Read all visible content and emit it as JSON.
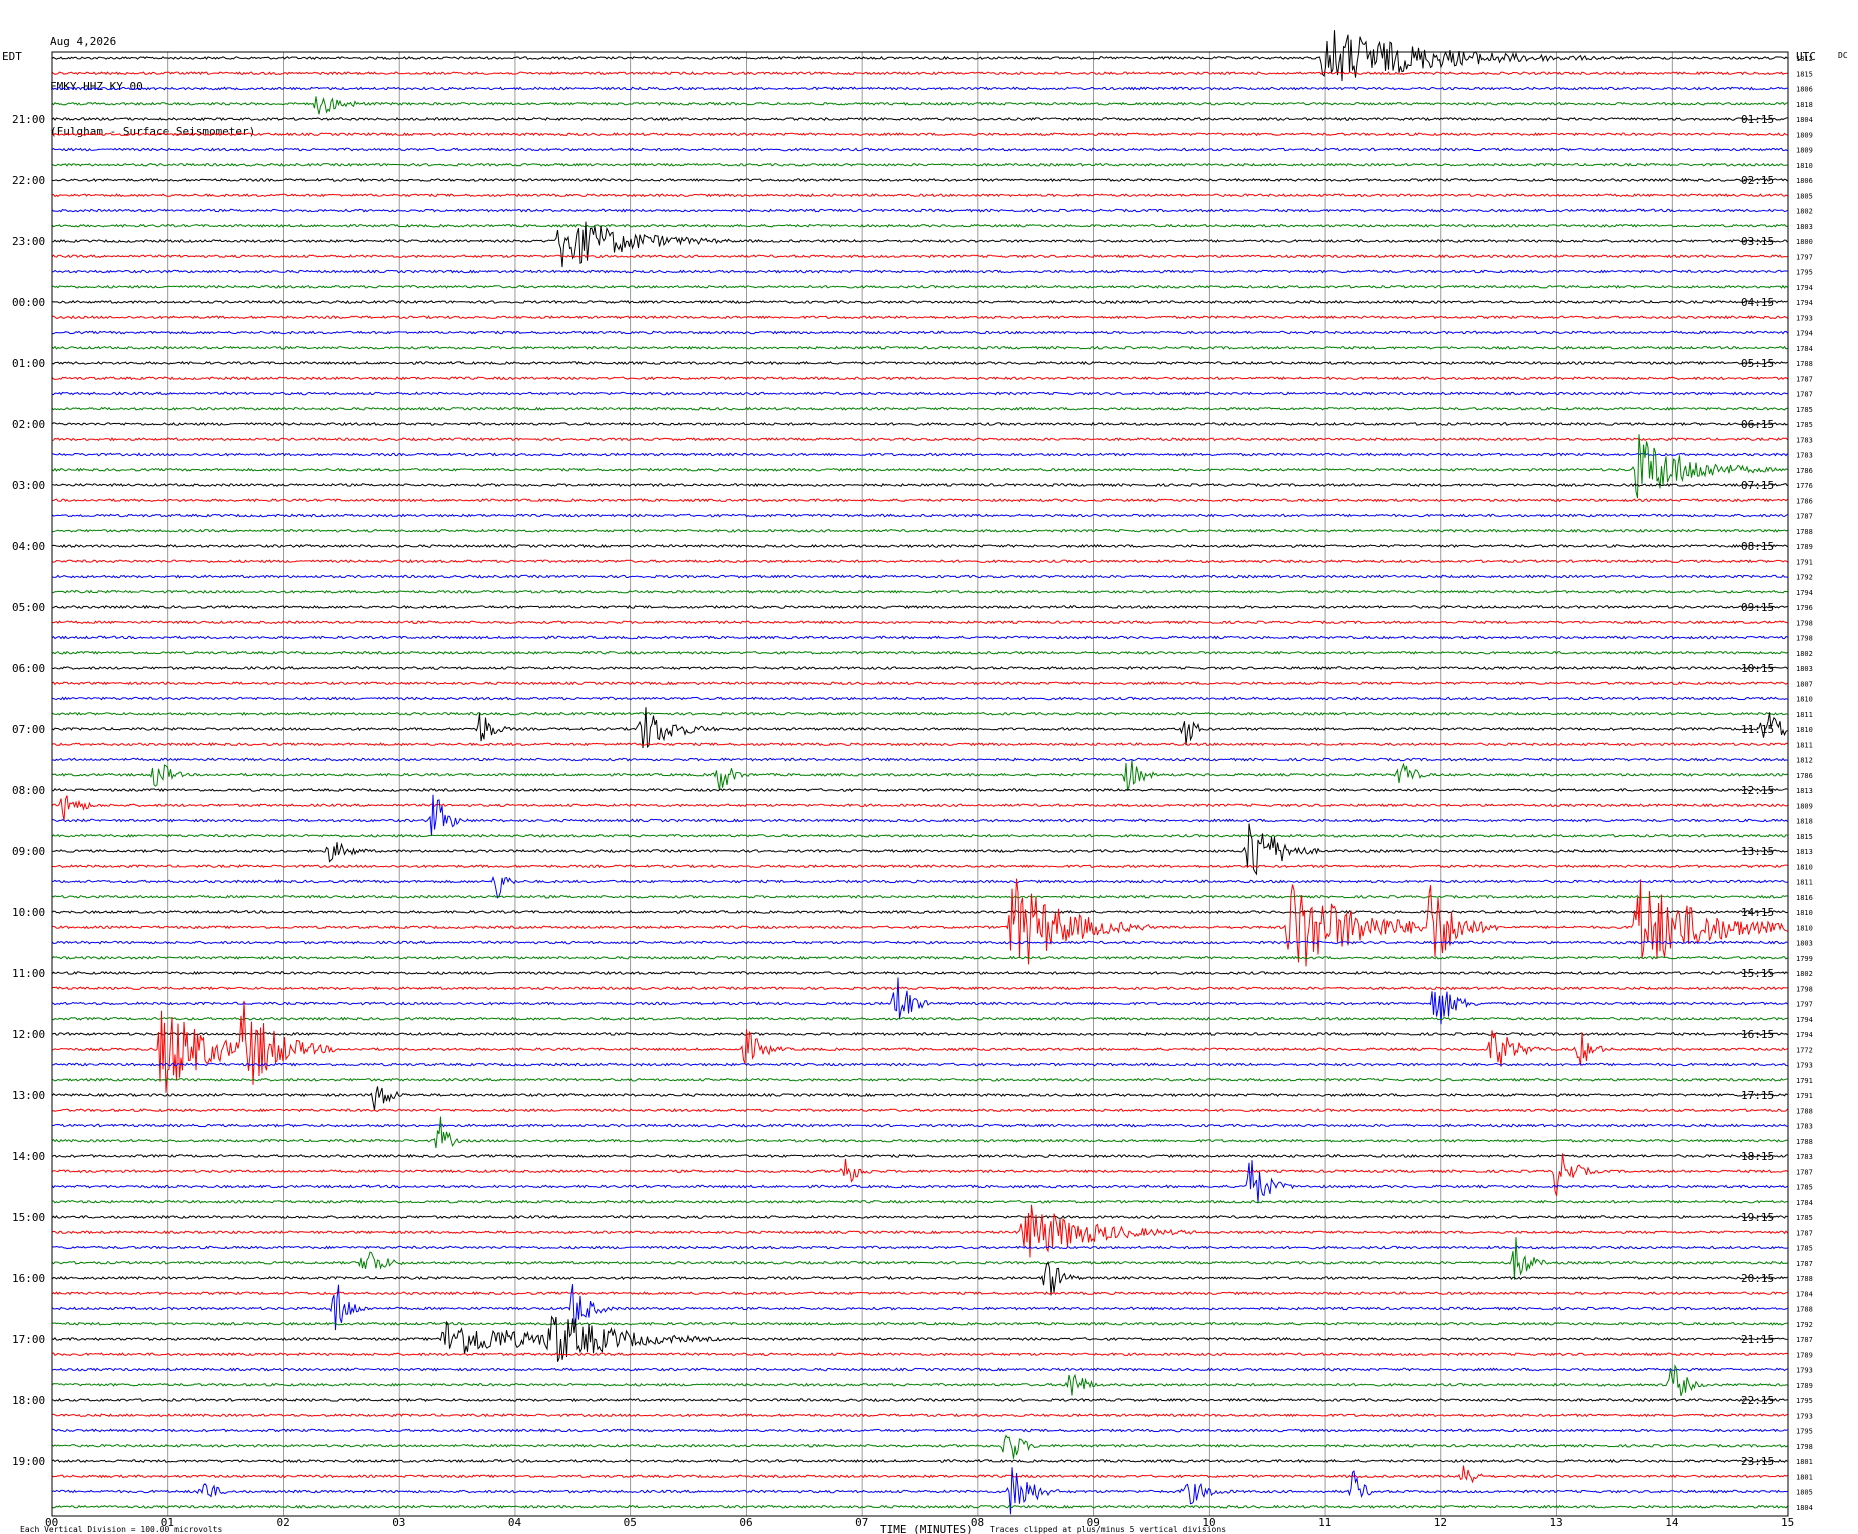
{
  "header": {
    "date": "Aug 4,2026",
    "station": "FMKY HHZ KY 00",
    "site": "(Fulgham - Surface Seismometer)"
  },
  "colors": {
    "trace_cycle": [
      "#000000",
      "#ff0000",
      "#0000ff",
      "#008000"
    ],
    "gridline": "#808080"
  },
  "chart_data": {
    "type": "line",
    "title": "",
    "left_timezone": "EDT",
    "right_timezone": "UTC",
    "dc_label": "DC",
    "xlabel": "TIME (MINUTES)",
    "xlim": [
      0,
      15
    ],
    "x_ticks": [
      "00",
      "01",
      "02",
      "03",
      "04",
      "05",
      "06",
      "07",
      "08",
      "09",
      "10",
      "11",
      "12",
      "13",
      "14",
      "15"
    ],
    "traces_per_hour": 4,
    "trace_minutes": 15,
    "trace_colors_cycle": [
      "black",
      "red",
      "blue",
      "green"
    ],
    "left_hour_labels": [
      "21:00",
      "22:00",
      "23:00",
      "00:00",
      "01:00",
      "02:00",
      "03:00",
      "04:00",
      "05:00",
      "06:00",
      "07:00",
      "08:00",
      "09:00",
      "10:00",
      "11:00",
      "12:00",
      "13:00",
      "14:00",
      "15:00",
      "16:00",
      "17:00",
      "18:00",
      "19:00"
    ],
    "right_hour_labels": [
      "01:15",
      "02:15",
      "03:15",
      "04:15",
      "05:15",
      "06:15",
      "07:15",
      "08:15",
      "09:15",
      "10:15",
      "11:15",
      "12:15",
      "13:15",
      "14:15",
      "15:15",
      "16:15",
      "17:15",
      "18:15",
      "19:15",
      "20:15",
      "21:15",
      "22:15",
      "23:15"
    ],
    "dc_offsets": [
      1812,
      1815,
      1806,
      1818,
      1804,
      1809,
      1809,
      1810,
      1806,
      1805,
      1802,
      1803,
      1800,
      1797,
      1795,
      1794,
      1794,
      1793,
      1794,
      1784,
      1788,
      1787,
      1787,
      1785,
      1785,
      1783,
      1783,
      1786,
      1776,
      1786,
      1787,
      1788,
      1789,
      1791,
      1792,
      1794,
      1796,
      1798,
      1798,
      1802,
      1803,
      1807,
      1810,
      1811,
      1810,
      1811,
      1812,
      1786,
      1813,
      1809,
      1818,
      1815,
      1813,
      1810,
      1811,
      1816,
      1810,
      1810,
      1803,
      1799,
      1802,
      1798,
      1797,
      1794,
      1794,
      1772,
      1793,
      1791,
      1791,
      1788,
      1783,
      1788,
      1783,
      1787,
      1785,
      1784,
      1785,
      1787,
      1785,
      1787,
      1788,
      1784,
      1788,
      1792,
      1787,
      1789,
      1793,
      1789,
      1795,
      1793,
      1795,
      1798,
      1801,
      1801,
      1805,
      1804
    ],
    "footer_scale": "Each Vertical Division =  100.00 microvolts",
    "footer_clip": "Traces clipped at plus/minus 5 vertical divisions",
    "events": [
      {
        "trace": 0,
        "minute": 11.0,
        "amp": 3.0,
        "dur": 2.5
      },
      {
        "trace": 3,
        "minute": 2.3,
        "amp": 1.2,
        "dur": 0.6
      },
      {
        "trace": 12,
        "minute": 4.4,
        "amp": 3.0,
        "dur": 1.5
      },
      {
        "trace": 27,
        "minute": 13.7,
        "amp": 3.5,
        "dur": 1.2
      },
      {
        "trace": 44,
        "minute": 3.7,
        "amp": 2.0,
        "dur": 0.3
      },
      {
        "trace": 44,
        "minute": 5.1,
        "amp": 2.5,
        "dur": 0.7
      },
      {
        "trace": 44,
        "minute": 9.8,
        "amp": 2.0,
        "dur": 0.2
      },
      {
        "trace": 44,
        "minute": 14.8,
        "amp": 2.5,
        "dur": 0.4
      },
      {
        "trace": 47,
        "minute": 0.9,
        "amp": 2.0,
        "dur": 0.3
      },
      {
        "trace": 47,
        "minute": 5.75,
        "amp": 2.2,
        "dur": 0.3
      },
      {
        "trace": 47,
        "minute": 9.3,
        "amp": 2.0,
        "dur": 0.3
      },
      {
        "trace": 47,
        "minute": 11.65,
        "amp": 1.8,
        "dur": 0.3
      },
      {
        "trace": 49,
        "minute": 0.1,
        "amp": 1.5,
        "dur": 0.4
      },
      {
        "trace": 50,
        "minute": 3.3,
        "amp": 3.0,
        "dur": 0.3
      },
      {
        "trace": 52,
        "minute": 10.35,
        "amp": 4.0,
        "dur": 0.6
      },
      {
        "trace": 52,
        "minute": 2.4,
        "amp": 1.2,
        "dur": 0.5
      },
      {
        "trace": 54,
        "minute": 3.85,
        "amp": 2.0,
        "dur": 0.2
      },
      {
        "trace": 57,
        "minute": 8.3,
        "amp": 5.0,
        "dur": 1.2
      },
      {
        "trace": 57,
        "minute": 10.7,
        "amp": 5.0,
        "dur": 1.5
      },
      {
        "trace": 57,
        "minute": 11.9,
        "amp": 5.0,
        "dur": 0.6
      },
      {
        "trace": 57,
        "minute": 13.7,
        "amp": 5.0,
        "dur": 1.5
      },
      {
        "trace": 62,
        "minute": 7.3,
        "amp": 3.5,
        "dur": 0.3
      },
      {
        "trace": 62,
        "minute": 11.95,
        "amp": 3.0,
        "dur": 0.4
      },
      {
        "trace": 65,
        "minute": 0.95,
        "amp": 5.0,
        "dur": 1.0
      },
      {
        "trace": 65,
        "minute": 1.65,
        "amp": 5.0,
        "dur": 0.8
      },
      {
        "trace": 65,
        "minute": 6.0,
        "amp": 2.0,
        "dur": 0.4
      },
      {
        "trace": 65,
        "minute": 12.45,
        "amp": 2.5,
        "dur": 0.5
      },
      {
        "trace": 65,
        "minute": 13.2,
        "amp": 2.0,
        "dur": 0.3
      },
      {
        "trace": 68,
        "minute": 2.8,
        "amp": 2.0,
        "dur": 0.3
      },
      {
        "trace": 71,
        "minute": 3.35,
        "amp": 2.5,
        "dur": 0.2
      },
      {
        "trace": 73,
        "minute": 6.85,
        "amp": 1.8,
        "dur": 0.3
      },
      {
        "trace": 73,
        "minute": 13.0,
        "amp": 2.5,
        "dur": 0.4
      },
      {
        "trace": 74,
        "minute": 10.35,
        "amp": 3.0,
        "dur": 0.4
      },
      {
        "trace": 77,
        "minute": 8.4,
        "amp": 3.0,
        "dur": 1.5
      },
      {
        "trace": 79,
        "minute": 2.7,
        "amp": 2.0,
        "dur": 0.4
      },
      {
        "trace": 79,
        "minute": 12.65,
        "amp": 2.5,
        "dur": 0.3
      },
      {
        "trace": 80,
        "minute": 8.6,
        "amp": 2.5,
        "dur": 0.3
      },
      {
        "trace": 82,
        "minute": 2.45,
        "amp": 3.0,
        "dur": 0.3
      },
      {
        "trace": 82,
        "minute": 4.5,
        "amp": 2.5,
        "dur": 0.4
      },
      {
        "trace": 84,
        "minute": 3.4,
        "amp": 2.0,
        "dur": 2.0
      },
      {
        "trace": 84,
        "minute": 4.3,
        "amp": 3.0,
        "dur": 1.5
      },
      {
        "trace": 87,
        "minute": 8.8,
        "amp": 2.0,
        "dur": 0.3
      },
      {
        "trace": 87,
        "minute": 14.0,
        "amp": 2.5,
        "dur": 0.3
      },
      {
        "trace": 91,
        "minute": 8.25,
        "amp": 2.5,
        "dur": 0.3
      },
      {
        "trace": 93,
        "minute": 12.2,
        "amp": 2.0,
        "dur": 0.2
      },
      {
        "trace": 94,
        "minute": 1.3,
        "amp": 1.5,
        "dur": 0.3
      },
      {
        "trace": 94,
        "minute": 8.3,
        "amp": 3.5,
        "dur": 0.4
      },
      {
        "trace": 94,
        "minute": 9.8,
        "amp": 1.5,
        "dur": 0.5
      },
      {
        "trace": 94,
        "minute": 11.25,
        "amp": 2.5,
        "dur": 0.2
      }
    ]
  }
}
